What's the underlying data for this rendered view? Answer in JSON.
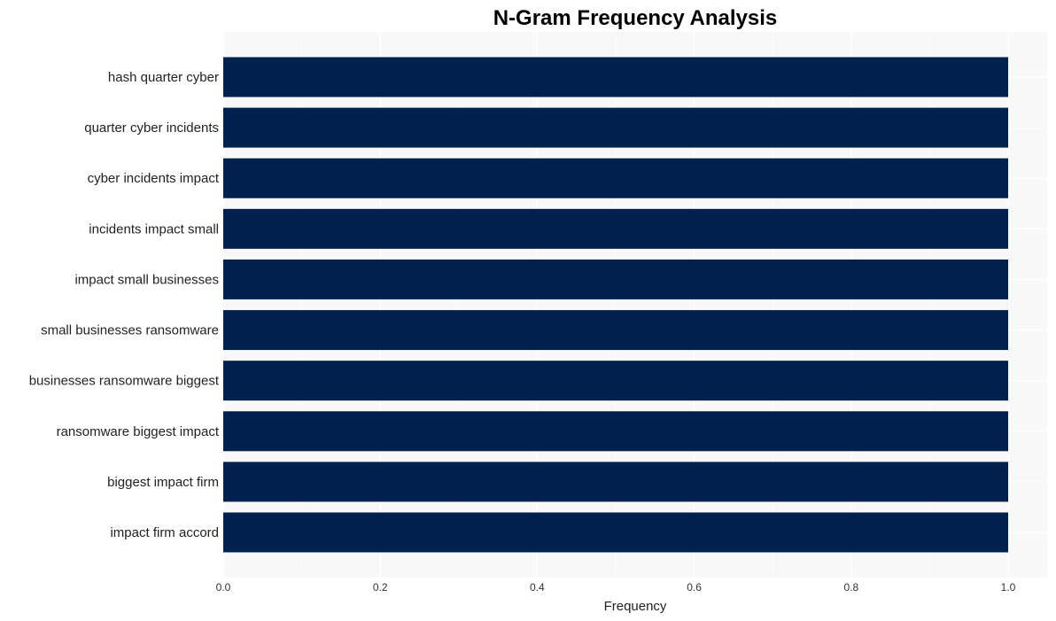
{
  "chart_data": {
    "type": "bar",
    "orientation": "horizontal",
    "title": "N-Gram Frequency Analysis",
    "xlabel": "Frequency",
    "ylabel": "",
    "categories": [
      "hash quarter cyber",
      "quarter cyber incidents",
      "cyber incidents impact",
      "incidents impact small",
      "impact small businesses",
      "small businesses ransomware",
      "businesses ransomware biggest",
      "ransomware biggest impact",
      "biggest impact firm",
      "impact firm accord"
    ],
    "values": [
      1,
      1,
      1,
      1,
      1,
      1,
      1,
      1,
      1,
      1
    ],
    "xlim": [
      0,
      1.05
    ],
    "xticks": [
      0.0,
      0.2,
      0.4,
      0.6,
      0.8,
      1.0
    ],
    "xtick_labels": [
      "0.0",
      "0.2",
      "0.4",
      "0.6",
      "0.8",
      "1.0"
    ],
    "grid": true,
    "legend": "none",
    "colors": {
      "bar": "#00214d",
      "plot_background": "#f8f8f8",
      "grid": "#ffffff"
    }
  }
}
